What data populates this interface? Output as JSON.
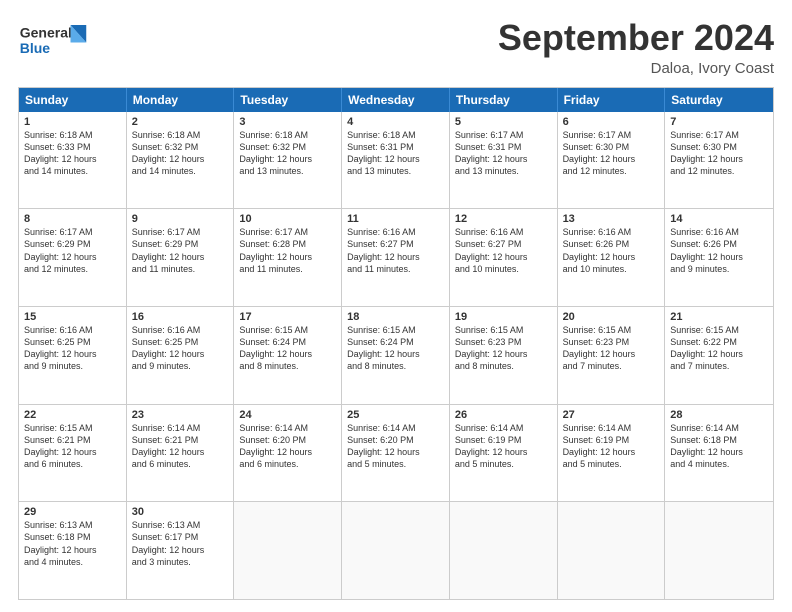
{
  "header": {
    "logo": {
      "line1": "General",
      "line2": "Blue"
    },
    "title": "September 2024",
    "subtitle": "Daloa, Ivory Coast"
  },
  "weekdays": [
    "Sunday",
    "Monday",
    "Tuesday",
    "Wednesday",
    "Thursday",
    "Friday",
    "Saturday"
  ],
  "weeks": [
    [
      {
        "day": "1",
        "lines": [
          "Sunrise: 6:18 AM",
          "Sunset: 6:33 PM",
          "Daylight: 12 hours",
          "and 14 minutes."
        ]
      },
      {
        "day": "2",
        "lines": [
          "Sunrise: 6:18 AM",
          "Sunset: 6:32 PM",
          "Daylight: 12 hours",
          "and 14 minutes."
        ]
      },
      {
        "day": "3",
        "lines": [
          "Sunrise: 6:18 AM",
          "Sunset: 6:32 PM",
          "Daylight: 12 hours",
          "and 13 minutes."
        ]
      },
      {
        "day": "4",
        "lines": [
          "Sunrise: 6:18 AM",
          "Sunset: 6:31 PM",
          "Daylight: 12 hours",
          "and 13 minutes."
        ]
      },
      {
        "day": "5",
        "lines": [
          "Sunrise: 6:17 AM",
          "Sunset: 6:31 PM",
          "Daylight: 12 hours",
          "and 13 minutes."
        ]
      },
      {
        "day": "6",
        "lines": [
          "Sunrise: 6:17 AM",
          "Sunset: 6:30 PM",
          "Daylight: 12 hours",
          "and 12 minutes."
        ]
      },
      {
        "day": "7",
        "lines": [
          "Sunrise: 6:17 AM",
          "Sunset: 6:30 PM",
          "Daylight: 12 hours",
          "and 12 minutes."
        ]
      }
    ],
    [
      {
        "day": "8",
        "lines": [
          "Sunrise: 6:17 AM",
          "Sunset: 6:29 PM",
          "Daylight: 12 hours",
          "and 12 minutes."
        ]
      },
      {
        "day": "9",
        "lines": [
          "Sunrise: 6:17 AM",
          "Sunset: 6:29 PM",
          "Daylight: 12 hours",
          "and 11 minutes."
        ]
      },
      {
        "day": "10",
        "lines": [
          "Sunrise: 6:17 AM",
          "Sunset: 6:28 PM",
          "Daylight: 12 hours",
          "and 11 minutes."
        ]
      },
      {
        "day": "11",
        "lines": [
          "Sunrise: 6:16 AM",
          "Sunset: 6:27 PM",
          "Daylight: 12 hours",
          "and 11 minutes."
        ]
      },
      {
        "day": "12",
        "lines": [
          "Sunrise: 6:16 AM",
          "Sunset: 6:27 PM",
          "Daylight: 12 hours",
          "and 10 minutes."
        ]
      },
      {
        "day": "13",
        "lines": [
          "Sunrise: 6:16 AM",
          "Sunset: 6:26 PM",
          "Daylight: 12 hours",
          "and 10 minutes."
        ]
      },
      {
        "day": "14",
        "lines": [
          "Sunrise: 6:16 AM",
          "Sunset: 6:26 PM",
          "Daylight: 12 hours",
          "and 9 minutes."
        ]
      }
    ],
    [
      {
        "day": "15",
        "lines": [
          "Sunrise: 6:16 AM",
          "Sunset: 6:25 PM",
          "Daylight: 12 hours",
          "and 9 minutes."
        ]
      },
      {
        "day": "16",
        "lines": [
          "Sunrise: 6:16 AM",
          "Sunset: 6:25 PM",
          "Daylight: 12 hours",
          "and 9 minutes."
        ]
      },
      {
        "day": "17",
        "lines": [
          "Sunrise: 6:15 AM",
          "Sunset: 6:24 PM",
          "Daylight: 12 hours",
          "and 8 minutes."
        ]
      },
      {
        "day": "18",
        "lines": [
          "Sunrise: 6:15 AM",
          "Sunset: 6:24 PM",
          "Daylight: 12 hours",
          "and 8 minutes."
        ]
      },
      {
        "day": "19",
        "lines": [
          "Sunrise: 6:15 AM",
          "Sunset: 6:23 PM",
          "Daylight: 12 hours",
          "and 8 minutes."
        ]
      },
      {
        "day": "20",
        "lines": [
          "Sunrise: 6:15 AM",
          "Sunset: 6:23 PM",
          "Daylight: 12 hours",
          "and 7 minutes."
        ]
      },
      {
        "day": "21",
        "lines": [
          "Sunrise: 6:15 AM",
          "Sunset: 6:22 PM",
          "Daylight: 12 hours",
          "and 7 minutes."
        ]
      }
    ],
    [
      {
        "day": "22",
        "lines": [
          "Sunrise: 6:15 AM",
          "Sunset: 6:21 PM",
          "Daylight: 12 hours",
          "and 6 minutes."
        ]
      },
      {
        "day": "23",
        "lines": [
          "Sunrise: 6:14 AM",
          "Sunset: 6:21 PM",
          "Daylight: 12 hours",
          "and 6 minutes."
        ]
      },
      {
        "day": "24",
        "lines": [
          "Sunrise: 6:14 AM",
          "Sunset: 6:20 PM",
          "Daylight: 12 hours",
          "and 6 minutes."
        ]
      },
      {
        "day": "25",
        "lines": [
          "Sunrise: 6:14 AM",
          "Sunset: 6:20 PM",
          "Daylight: 12 hours",
          "and 5 minutes."
        ]
      },
      {
        "day": "26",
        "lines": [
          "Sunrise: 6:14 AM",
          "Sunset: 6:19 PM",
          "Daylight: 12 hours",
          "and 5 minutes."
        ]
      },
      {
        "day": "27",
        "lines": [
          "Sunrise: 6:14 AM",
          "Sunset: 6:19 PM",
          "Daylight: 12 hours",
          "and 5 minutes."
        ]
      },
      {
        "day": "28",
        "lines": [
          "Sunrise: 6:14 AM",
          "Sunset: 6:18 PM",
          "Daylight: 12 hours",
          "and 4 minutes."
        ]
      }
    ],
    [
      {
        "day": "29",
        "lines": [
          "Sunrise: 6:13 AM",
          "Sunset: 6:18 PM",
          "Daylight: 12 hours",
          "and 4 minutes."
        ]
      },
      {
        "day": "30",
        "lines": [
          "Sunrise: 6:13 AM",
          "Sunset: 6:17 PM",
          "Daylight: 12 hours",
          "and 3 minutes."
        ]
      },
      {
        "day": "",
        "lines": []
      },
      {
        "day": "",
        "lines": []
      },
      {
        "day": "",
        "lines": []
      },
      {
        "day": "",
        "lines": []
      },
      {
        "day": "",
        "lines": []
      }
    ]
  ]
}
